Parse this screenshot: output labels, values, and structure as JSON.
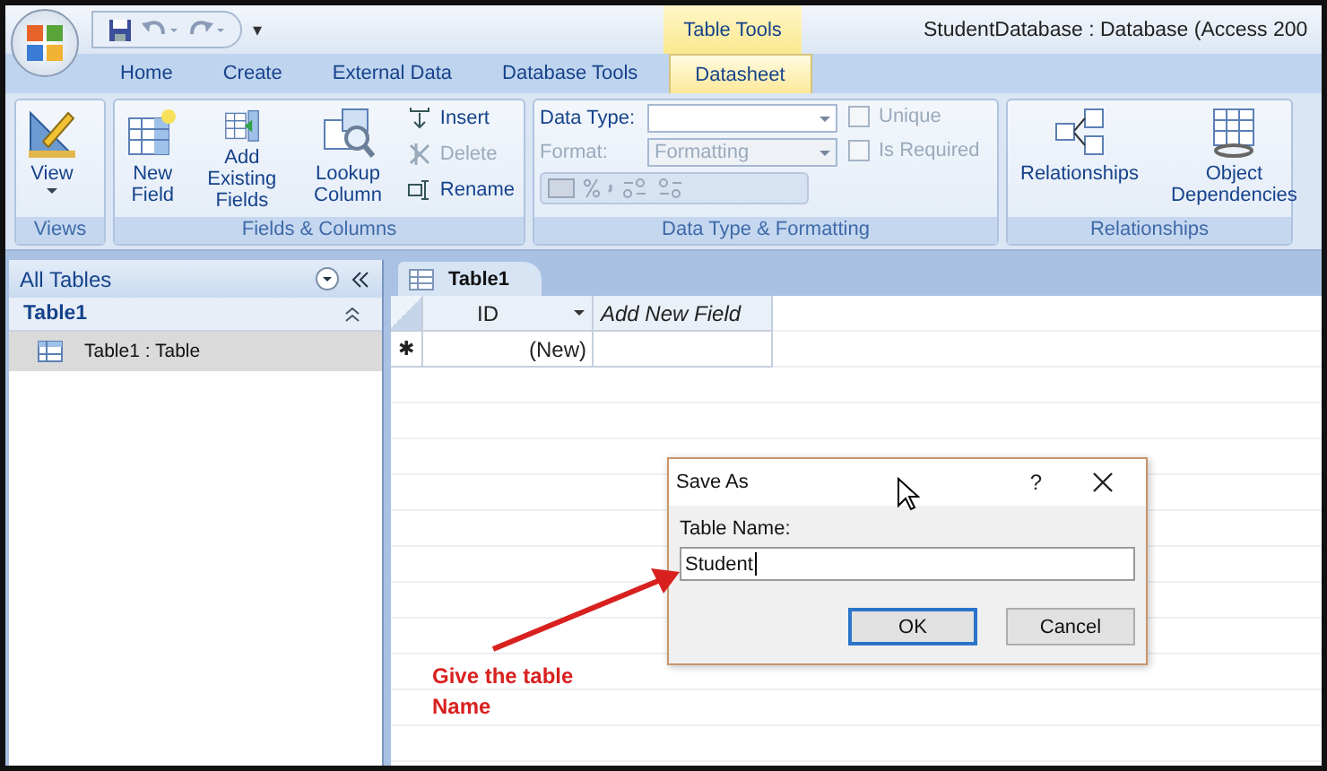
{
  "window": {
    "title": "StudentDatabase : Database (Access 200",
    "contextual_tab": "Table Tools",
    "qat_menu": "▾"
  },
  "tabs": [
    {
      "label": "Home",
      "selected": false
    },
    {
      "label": "Create",
      "selected": false
    },
    {
      "label": "External Data",
      "selected": false
    },
    {
      "label": "Database Tools",
      "selected": false
    },
    {
      "label": "Datasheet",
      "selected": true
    }
  ],
  "ribbon": {
    "groups": [
      {
        "title": "Views",
        "items": [
          {
            "kind": "large",
            "label": "View",
            "dropdown": true,
            "disabled": false
          }
        ]
      },
      {
        "title": "Fields & Columns",
        "items": [
          {
            "kind": "large",
            "label": "New Field",
            "disabled": false
          },
          {
            "kind": "large",
            "label": "Add Existing Fields",
            "disabled": false
          },
          {
            "kind": "large",
            "label": "Lookup Column",
            "disabled": false
          },
          {
            "kind": "small",
            "label": "Insert",
            "disabled": false
          },
          {
            "kind": "small",
            "label": "Delete",
            "disabled": true
          },
          {
            "kind": "small",
            "label": "Rename",
            "disabled": false
          }
        ]
      },
      {
        "title": "Data Type & Formatting",
        "items": [
          {
            "kind": "combo",
            "label": "Data Type:",
            "disabled": false
          },
          {
            "kind": "combo",
            "label": "Format:",
            "placeholder": "Formatting",
            "disabled": true
          },
          {
            "kind": "format-row",
            "disabled": true
          },
          {
            "kind": "checkbox",
            "label": "Unique",
            "checked": false,
            "disabled": true
          },
          {
            "kind": "checkbox",
            "label": "Is Required",
            "checked": false,
            "disabled": true
          }
        ]
      },
      {
        "title": "Relationships",
        "items": [
          {
            "kind": "large",
            "label": "Relationships",
            "disabled": false
          },
          {
            "kind": "large",
            "label": "Object Dependencies",
            "disabled": false
          }
        ]
      }
    ]
  },
  "nav_pane": {
    "header": "All Tables",
    "groups": [
      {
        "title": "Table1",
        "expanded": true,
        "children": [
          {
            "label": "Table1 : Table",
            "selected": true
          }
        ]
      }
    ]
  },
  "document_tabs": [
    {
      "label": "Table1",
      "selected": true
    }
  ],
  "datasheet": {
    "columns": [
      {
        "label": "ID",
        "italic": false
      },
      {
        "label": "Add New Field",
        "italic": true
      }
    ],
    "rows": [
      {
        "marker": "✱",
        "cells": [
          "(New)"
        ]
      }
    ]
  },
  "dialog": {
    "title": "Save As",
    "help": "?",
    "field_label": "Table Name:",
    "value": "Student",
    "buttons": [
      {
        "label": "OK",
        "default": true
      },
      {
        "label": "Cancel",
        "default": false
      }
    ]
  },
  "annotation": {
    "text": "Give the table Name"
  }
}
